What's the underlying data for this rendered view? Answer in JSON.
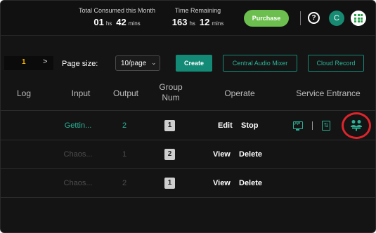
{
  "header": {
    "consumed": {
      "label": "Total Consumed this Month",
      "hours": "01",
      "hours_unit": "hs",
      "mins": "42",
      "mins_unit": "mins"
    },
    "remaining": {
      "label": "Time Remaining",
      "hours": "163",
      "hours_unit": "hs",
      "mins": "12",
      "mins_unit": "mins"
    },
    "purchase_label": "Purchase",
    "help_glyph": "?",
    "avatar_initial": "C",
    "colors": {
      "purchase": "#6cbf4e",
      "avatar": "#178a72",
      "apps": "#2aa14a"
    }
  },
  "toolbar": {
    "page_number": "1",
    "page_next_glyph": ">",
    "page_size_label": "Page size:",
    "page_size_value": "10/page",
    "create_label": "Create",
    "mixer_label": "Central Audio Mixer",
    "cloud_label": "Cloud Record",
    "accent": "#138a76"
  },
  "table": {
    "headers": {
      "log": "Log",
      "input": "Input",
      "output": "Output",
      "group_line1": "Group",
      "group_line2": "Num",
      "operate": "Operate",
      "service": "Service Entrance"
    },
    "rows": [
      {
        "input": "Gettin...",
        "output": "2",
        "group": "1",
        "op1": "Edit",
        "op2": "Stop",
        "state": "active"
      },
      {
        "input": "Chaos...",
        "output": "1",
        "group": "2",
        "op1": "View",
        "op2": "Delete",
        "state": "dim"
      },
      {
        "input": "Chaos...",
        "output": "2",
        "group": "1",
        "op1": "View",
        "op2": "Delete",
        "state": "dim"
      }
    ],
    "service_icons": [
      "presentation-icon",
      "switch-icon",
      "meeting-icon"
    ],
    "highlight_color": "#e0242c"
  }
}
